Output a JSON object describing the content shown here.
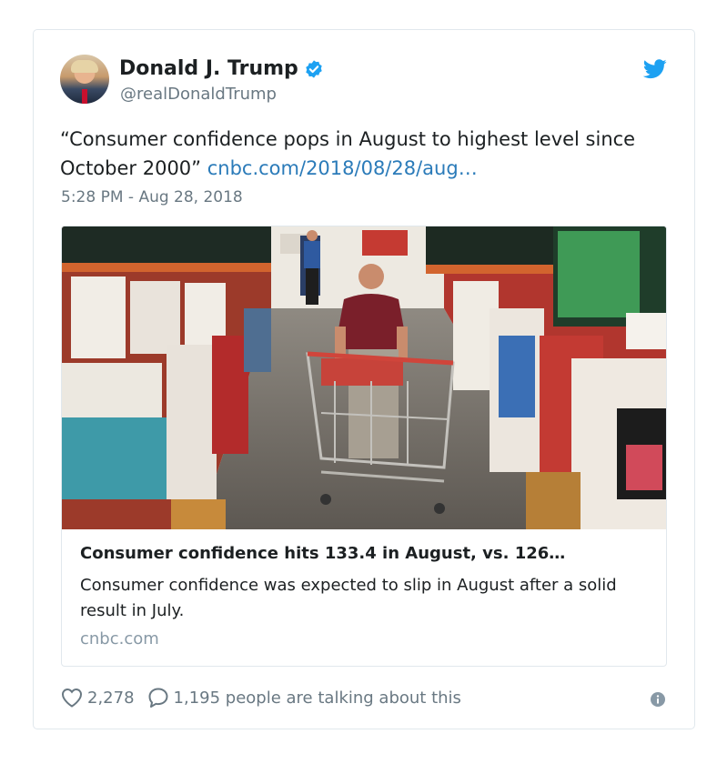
{
  "tweet": {
    "author_name": "Donald J. Trump",
    "author_handle": "@realDonaldTrump",
    "text": "“Consumer confidence pops in August to highest level since October 2000”",
    "link_text": "cnbc.com/2018/08/28/aug…",
    "timestamp": "5:28 PM - Aug 28, 2018"
  },
  "card": {
    "title": "Consumer confidence hits 133.4 in August, vs. 126…",
    "description": "Consumer confidence was expected to slip in August after a solid result in July.",
    "domain": "cnbc.com"
  },
  "footer": {
    "likes": "2,278",
    "replies": "1,195 people are talking about this"
  },
  "colors": {
    "link": "#2b7bb9",
    "verified": "#1da1f2",
    "muted": "#697882",
    "border": "#e1e8ed"
  },
  "icons": [
    "verified-badge-icon",
    "twitter-bird-icon",
    "heart-icon",
    "reply-bubble-icon",
    "info-icon"
  ]
}
